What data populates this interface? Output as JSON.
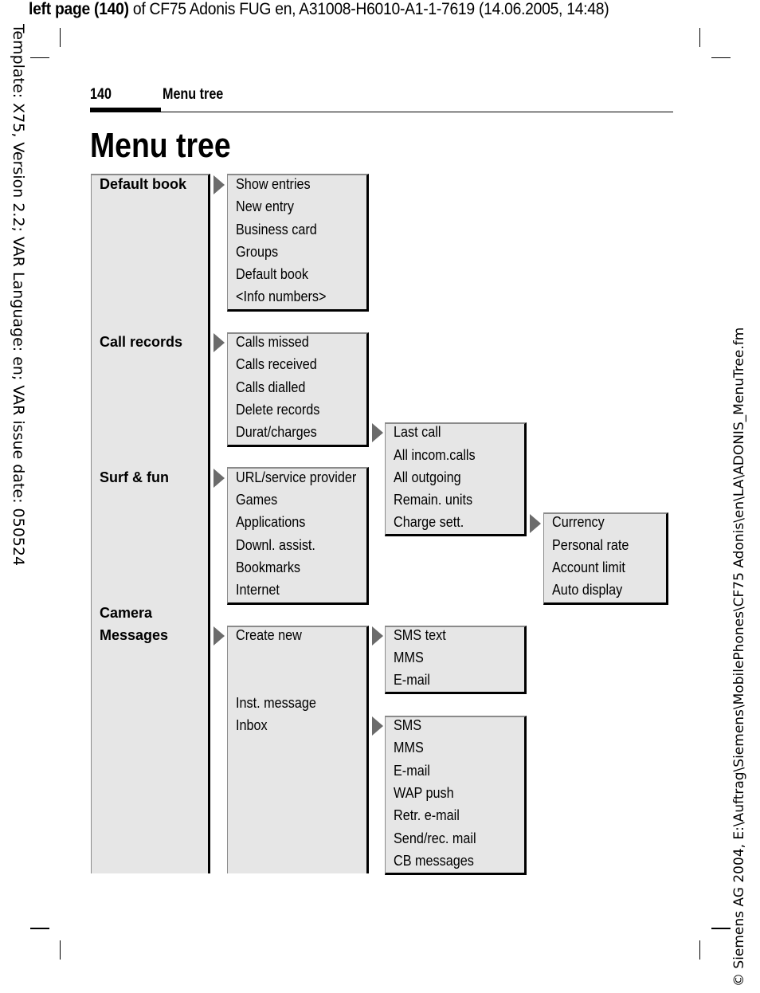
{
  "print_header": {
    "bold_part": "left page (140)",
    "rest": " of CF75 Adonis FUG en, A31008-H6010-A1-1-7619 (14.06.2005, 14:48)"
  },
  "side_text_left": "Template: X75, Version 2.2; VAR Language: en; VAR issue date: 050524",
  "side_text_right": "© Siemens AG 2004, E:\\Auftrag\\Siemens\\MobilePhones\\CF75 Adonis\\en\\LA\\ADONIS_MenuTree.fm",
  "page": {
    "number": "140",
    "running_title": "Menu tree",
    "heading": "Menu tree"
  },
  "menu": {
    "main": [
      "Default book",
      "Call records",
      "Surf & fun",
      "Camera",
      "Messages"
    ],
    "default_book": [
      "Show entries",
      "New entry",
      "Business card",
      "Groups",
      "Default book",
      "<Info numbers>"
    ],
    "call_records": [
      "Calls missed",
      "Calls received",
      "Calls dialled",
      "Delete records",
      "Durat/charges"
    ],
    "durat_charges": [
      "Last call",
      "All incom.calls",
      "All outgoing",
      "Remain. units",
      "Charge sett."
    ],
    "charge_sett": [
      "Currency",
      "Personal rate",
      "Account limit",
      "Auto display"
    ],
    "surf_fun": [
      "URL/service provider",
      "Games",
      "Applications",
      "Downl. assist.",
      "Bookmarks",
      "Internet"
    ],
    "messages": [
      "Create new",
      "Inst. message",
      "Inbox"
    ],
    "create_new": [
      "SMS text",
      "MMS",
      "E-mail"
    ],
    "inbox": [
      "SMS",
      "MMS",
      "E-mail",
      "WAP push",
      "Retr. e-mail",
      "Send/rec. mail",
      "CB messages"
    ]
  }
}
